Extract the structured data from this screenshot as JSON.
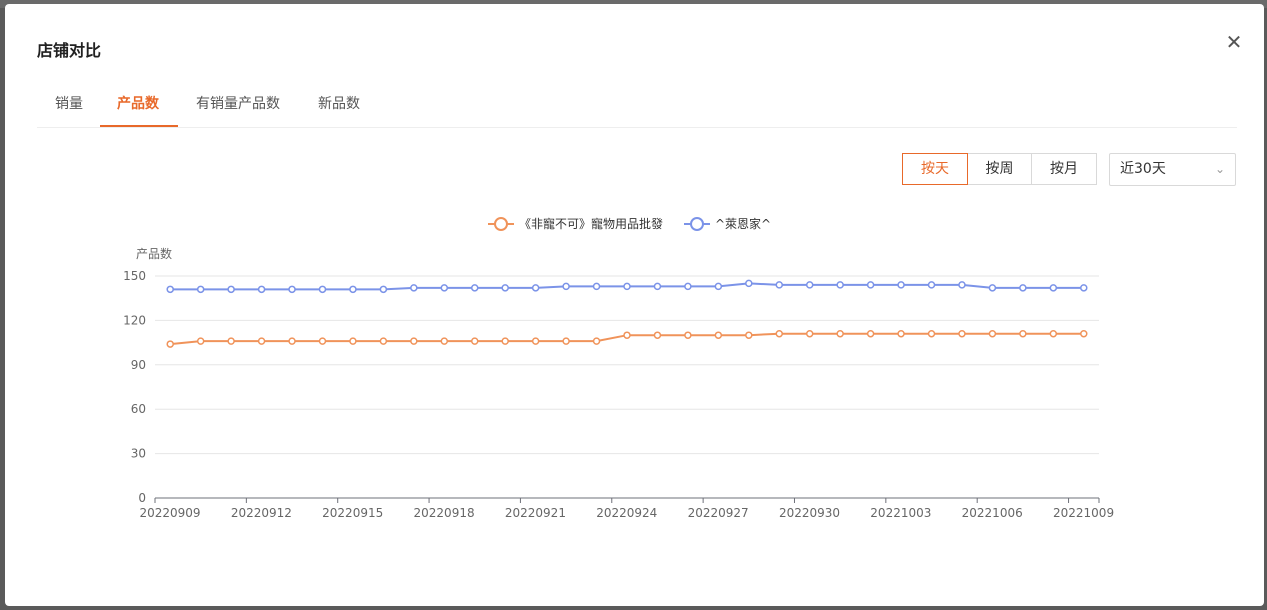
{
  "backdrop": {
    "bottom_text": ""
  },
  "modal": {
    "title": "店铺对比",
    "close_icon": "close-icon"
  },
  "tabs": [
    {
      "label": "销量",
      "active": false
    },
    {
      "label": "产品数",
      "active": true
    },
    {
      "label": "有销量产品数",
      "active": false
    },
    {
      "label": "新品数",
      "active": false
    }
  ],
  "granularity": {
    "day": "按天",
    "week": "按周",
    "month": "按月",
    "selected": "day"
  },
  "range_select": {
    "value": "近30天",
    "icon": "chevron-down-icon"
  },
  "colors": {
    "accent": "#e8692a",
    "series1": "#f0935a",
    "series2": "#7b93e8"
  },
  "chart_data": {
    "type": "line",
    "ylabel": "产品数",
    "ylim": [
      0,
      150
    ],
    "yticks": [
      0,
      30,
      60,
      90,
      120,
      150
    ],
    "x": [
      "20220909",
      "20220910",
      "20220911",
      "20220912",
      "20220913",
      "20220914",
      "20220915",
      "20220916",
      "20220917",
      "20220918",
      "20220919",
      "20220920",
      "20220921",
      "20220922",
      "20220923",
      "20220924",
      "20220925",
      "20220926",
      "20220927",
      "20220928",
      "20220929",
      "20220930",
      "20221001",
      "20221002",
      "20221003",
      "20221004",
      "20221005",
      "20221006",
      "20221007",
      "20221008",
      "20221009"
    ],
    "xticks": [
      "20220909",
      "20220912",
      "20220915",
      "20220918",
      "20220921",
      "20220924",
      "20220927",
      "20220930",
      "20221003",
      "20221006",
      "20221009"
    ],
    "legend_position": "top",
    "series": [
      {
        "name": "《非寵不可》寵物用品批發",
        "values": [
          104,
          106,
          106,
          106,
          106,
          106,
          106,
          106,
          106,
          106,
          106,
          106,
          106,
          106,
          106,
          110,
          110,
          110,
          110,
          110,
          111,
          111,
          111,
          111,
          111,
          111,
          111,
          111,
          111,
          111,
          111
        ]
      },
      {
        "name": "^萊恩家^",
        "values": [
          141,
          141,
          141,
          141,
          141,
          141,
          141,
          141,
          142,
          142,
          142,
          142,
          142,
          143,
          143,
          143,
          143,
          143,
          143,
          145,
          144,
          144,
          144,
          144,
          144,
          144,
          144,
          142,
          142,
          142,
          142
        ]
      }
    ]
  }
}
